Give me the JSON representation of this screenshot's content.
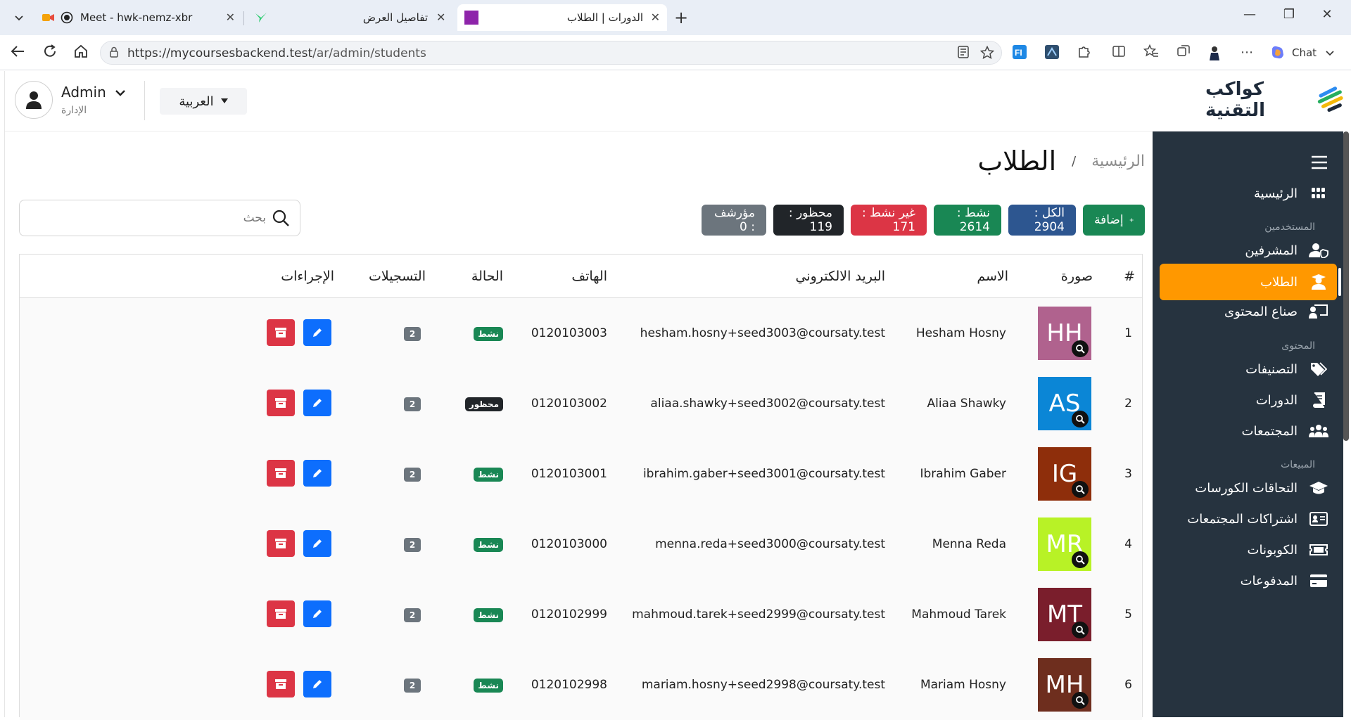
{
  "browser": {
    "tabs": [
      {
        "title": "Meet - hwk-nemz-xbr"
      },
      {
        "title": "تفاصيل العرض"
      },
      {
        "title": "الدورات | الطلاب"
      }
    ],
    "url_host": "https://mycoursesbackend.test",
    "url_path": "/ar/admin/students",
    "chat_label": "Chat"
  },
  "header": {
    "user_name": "Admin",
    "user_role": "الإدارة",
    "language": "العربية",
    "brand_name": "كواكب التقنية"
  },
  "sidebar": {
    "items": [
      {
        "label": "الرئيسية",
        "icon": "grid-icon"
      },
      {
        "section": "المستخدمين"
      },
      {
        "label": "المشرفين",
        "icon": "user-shield-icon"
      },
      {
        "label": "الطلاب",
        "icon": "student-icon",
        "active": true
      },
      {
        "label": "صناع المحتوى",
        "icon": "chalkboard-icon"
      },
      {
        "section": "المحتوى"
      },
      {
        "label": "التصنيفات",
        "icon": "tags-icon"
      },
      {
        "label": "الدورات",
        "icon": "book-icon"
      },
      {
        "label": "المجتمعات",
        "icon": "users-icon"
      },
      {
        "section": "المبيعات"
      },
      {
        "label": "التحاقات الكورسات",
        "icon": "graduation-cap-icon"
      },
      {
        "label": "اشتراكات المجتمعات",
        "icon": "id-card-icon"
      },
      {
        "label": "الكوبونات",
        "icon": "ticket-icon"
      },
      {
        "label": "المدفوعات",
        "icon": "credit-card-icon"
      }
    ]
  },
  "page": {
    "breadcrumb_home": "الرئيسية",
    "breadcrumb_sep": "/",
    "title": "الطلاب",
    "add_label": "إضافة",
    "stats": {
      "all": "الكل : 2904",
      "active": "نشط : 2614",
      "inactive": "غير نشط : 171",
      "banned": "محظور : 119",
      "archived": "مؤرشف : 0"
    },
    "search_placeholder": "بحث"
  },
  "colors": {
    "add": "#198754",
    "all": "#2d5690",
    "active": "#198754",
    "inactive": "#dc3545",
    "banned": "#212529",
    "archived": "#6c757d",
    "edit": "#0d6efd",
    "delete": "#dc3545",
    "sidebar": "#26333f",
    "sidebar_active": "#ff9800"
  },
  "table": {
    "headers": {
      "index": "#",
      "photo": "صورة",
      "name": "الاسم",
      "email": "البريد الالكتروني",
      "phone": "الهاتف",
      "status": "الحالة",
      "enrollments": "التسجيلات",
      "actions": "الإجراءات"
    },
    "rows": [
      {
        "index": "1",
        "initials": "HH",
        "color": "#b0628e",
        "name": "Hesham Hosny",
        "email": "hesham.hosny+seed3003@coursaty.test",
        "phone": "0120103003",
        "status": "نشط",
        "status_color": "#198754",
        "enrollments": "2"
      },
      {
        "index": "2",
        "initials": "AS",
        "color": "#0b86d6",
        "name": "Aliaa Shawky",
        "email": "aliaa.shawky+seed3002@coursaty.test",
        "phone": "0120103002",
        "status": "محظور",
        "status_color": "#212529",
        "enrollments": "2"
      },
      {
        "index": "3",
        "initials": "IG",
        "color": "#8e2e0b",
        "name": "Ibrahim Gaber",
        "email": "ibrahim.gaber+seed3001@coursaty.test",
        "phone": "0120103001",
        "status": "نشط",
        "status_color": "#198754",
        "enrollments": "2"
      },
      {
        "index": "4",
        "initials": "MR",
        "color": "#b8f226",
        "name": "Menna Reda",
        "email": "menna.reda+seed3000@coursaty.test",
        "phone": "0120103000",
        "status": "نشط",
        "status_color": "#198754",
        "enrollments": "2"
      },
      {
        "index": "5",
        "initials": "MT",
        "color": "#7a1e2c",
        "name": "Mahmoud Tarek",
        "email": "mahmoud.tarek+seed2999@coursaty.test",
        "phone": "0120102999",
        "status": "نشط",
        "status_color": "#198754",
        "enrollments": "2"
      },
      {
        "index": "6",
        "initials": "MH",
        "color": "#6e2e1e",
        "name": "Mariam Hosny",
        "email": "mariam.hosny+seed2998@coursaty.test",
        "phone": "0120102998",
        "status": "نشط",
        "status_color": "#198754",
        "enrollments": "2"
      }
    ]
  }
}
